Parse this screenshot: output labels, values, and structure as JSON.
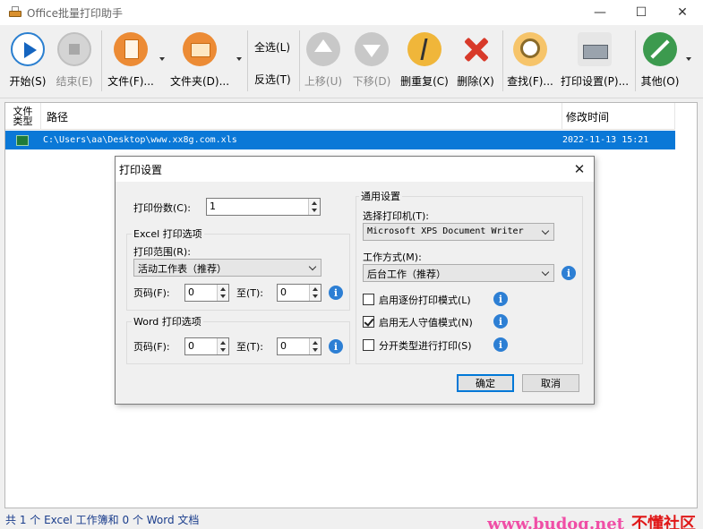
{
  "window": {
    "title": "Office批量打印助手",
    "minimize": "—",
    "maximize": "☐",
    "close": "✕"
  },
  "toolbar": {
    "start": "开始(S)",
    "end": "结束(E)",
    "file": "文件(F)...",
    "folder": "文件夹(D)...",
    "select_all": "全选(L)",
    "invert": "反选(T)",
    "move_up": "上移(U)",
    "move_down": "下移(D)",
    "delete_dup": "删重复(C)",
    "delete": "删除(X)",
    "find": "查找(F)...",
    "print_settings": "打印设置(P)...",
    "other": "其他(O)"
  },
  "list": {
    "columns": {
      "type": "文件类型",
      "path": "路径",
      "modified": "修改时间"
    },
    "rows": [
      {
        "path": "C:\\Users\\aa\\Desktop\\www.xx8g.com.xls",
        "modified": "2022-11-13 15:21"
      }
    ]
  },
  "status": {
    "text": "共 1 个 Excel 工作簿和 0 个 Word 文档",
    "watermark_url": "www.budog.net",
    "watermark_name": "不懂社区"
  },
  "dialog": {
    "title": "打印设置",
    "close": "✕",
    "copies_label": "打印份数(C):",
    "copies_value": "1",
    "excel_group": "Excel 打印选项",
    "range_label": "打印范围(R):",
    "range_value": "活动工作表（推荐）",
    "excel_pages_label": "页码(F):",
    "excel_from": "0",
    "excel_to_label": "至(T):",
    "excel_to": "0",
    "word_group": "Word 打印选项",
    "word_pages_label": "页码(F):",
    "word_from": "0",
    "word_to_label": "至(T):",
    "word_to": "0",
    "general_group": "通用设置",
    "printer_label": "选择打印机(T):",
    "printer_value": "Microsoft XPS Document Writer",
    "mode_label": "工作方式(M):",
    "mode_value": "后台工作（推荐）",
    "opt_collate": "启用逐份打印模式(L)",
    "opt_unattended": "启用无人守值模式(N)",
    "opt_bytype": "分开类型进行打印(S)",
    "ok": "确定",
    "cancel": "取消",
    "info_glyph": "i"
  }
}
